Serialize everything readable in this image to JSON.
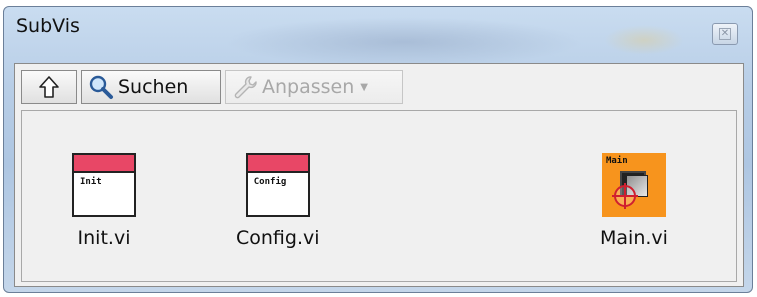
{
  "window": {
    "title": "SubVis"
  },
  "toolbar": {
    "up_icon": "arrow-up-icon",
    "search_label": "Suchen",
    "search_icon": "magnifier-icon",
    "adjust_label": "Anpassen",
    "adjust_icon": "wrench-icon",
    "adjust_enabled": false
  },
  "items": [
    {
      "icon_text": "Init",
      "name": "Init.vi",
      "bar_color": "#e84766"
    },
    {
      "icon_text": "Config",
      "name": "Config.vi",
      "bar_color": "#e84766"
    },
    {
      "icon_text": "Main",
      "name": "Main.vi",
      "bar_color": "#f7941d"
    }
  ],
  "colors": {
    "title_bar": "#b7cde6",
    "vi_header": "#e84766",
    "main_icon_bg": "#f7941d",
    "disabled_text": "#a8a8a8"
  }
}
